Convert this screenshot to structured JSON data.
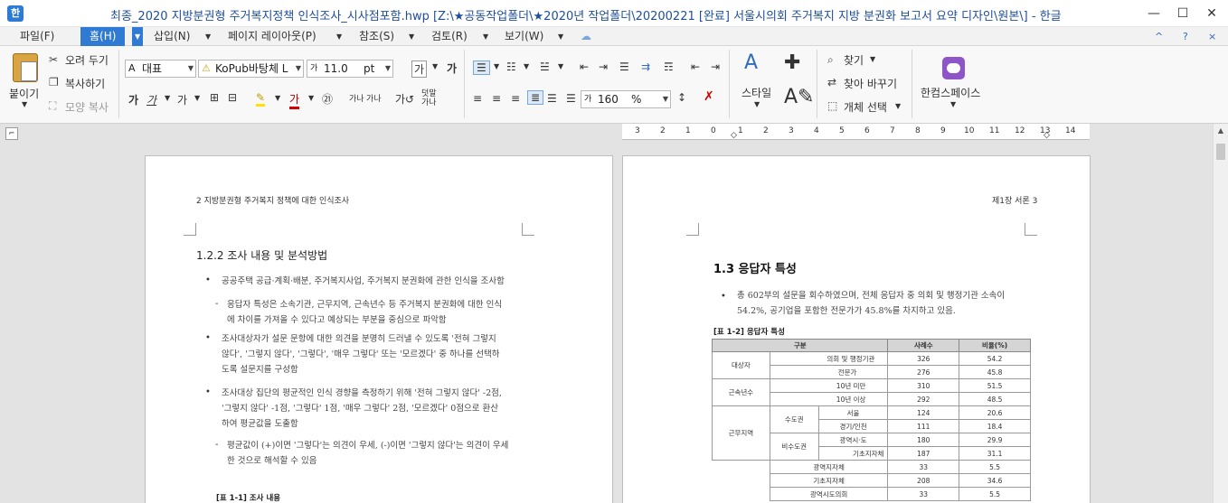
{
  "window": {
    "title": "최종_2020 지방분권형 주거복지정책 인식조사_시사점포함.hwp [Z:\\★공동작업폴더\\★2020년 작업폴더\\20200221 [완료] 서울시의회 주거복지 지방 분권화 보고서 요약 디자인\\원본\\] - 한글",
    "app_icon": "한",
    "controls": [
      "—",
      "☐",
      "✕"
    ]
  },
  "menu": {
    "items": [
      "파일(F)",
      "홈(H)",
      "삽입(N)",
      "페이지 레이아웃(P)",
      "참조(S)",
      "검토(R)",
      "보기(W)"
    ],
    "right": [
      "^",
      "?",
      "×"
    ]
  },
  "ribbon": {
    "paste": "붙이기",
    "cut": "오려 두기",
    "copy": "복사하기",
    "format_copy": "모양 복사",
    "style_combo": "대표",
    "font_combo": "KoPub바탕체 L",
    "size_combo": "11.0",
    "size_unit": "pt",
    "font_glyph_1": "가",
    "font_glyph_2": "가",
    "font_row2": [
      "가",
      "가",
      "가"
    ],
    "circle_num": "㉑",
    "line_spacing": "160",
    "line_spacing_unit": "%",
    "style_btn": "스타일",
    "find": "찾기",
    "replace": "찾아 바꾸기",
    "select_obj": "개체 선택",
    "hancom_space": "한컴스페이스"
  },
  "ruler": {
    "numbers": [
      "3",
      "2",
      "1",
      "0",
      "1",
      "2",
      "3",
      "4",
      "5",
      "6",
      "7",
      "8",
      "9",
      "10",
      "11",
      "12",
      "13",
      "14"
    ]
  },
  "left_page": {
    "header": "2  지방분권형  주거복지  정책에  대한  인식조사",
    "section_title": "1.2.2  조사  내용  및  분석방법",
    "paragraphs": [
      {
        "marker": "•",
        "lines": [
          "공공주택 공급·계획·배분, 주거복지사업, 주거복지 분권화에 관한 인식을 조사함"
        ]
      },
      {
        "marker": "-",
        "lines": [
          "응답자 특성은 소속기관, 근무지역, 근속년수 등 주거복지 분권화에 대한 인식",
          "에 차이를 가져올 수 있다고 예상되는 부분을 중심으로 파악함"
        ]
      },
      {
        "marker": "•",
        "lines": [
          "조사대상자가 설문 문항에 대한 의견을 분명히 드러낼 수 있도록 '전혀 그렇지",
          "않다', '그렇지 않다', '그렇다', '매우 그렇다' 또는 '모르겠다' 중 하나를 선택하",
          "도록 설문지를 구성함"
        ]
      },
      {
        "marker": "•",
        "lines": [
          "조사대상 집단의 평균적인 인식 경향을 측정하기 위해 '전혀 그렇지 않다' -2점,",
          "'그렇지 않다' -1점, '그렇다' 1점, '매우 그렇다' 2점, '모르겠다' 0점으로 환산",
          "하여 평균값을 도출함"
        ]
      },
      {
        "marker": "-",
        "lines": [
          "평균값이 (+)이면 '그렇다'는 의견이 우세, (-)이면 '그렇지 않다'는 의견이 우세",
          "한 것으로 해석할 수 있음"
        ]
      }
    ],
    "table_caption": "[표 1-1] 조사 내용"
  },
  "right_page": {
    "header": "제1장  서론  3",
    "section_title": "1.3  응답자  특성",
    "paragraph": [
      "총  602부의  설문을  회수하였으며,  전체  응답자  중  의회  및  행정기관  소속이",
      "54.2%,  공기업을  포함한  전문가가  45.8%를  차지하고  있음."
    ],
    "table_caption": "[표  1-2]  응답자  특성",
    "table": {
      "headers": [
        "구분",
        "사례수",
        "비율(%)"
      ],
      "rows": [
        {
          "g1": "대상자",
          "g2": "",
          "g3": "의회 및 행정기관",
          "n": "326",
          "p": "54.2"
        },
        {
          "g1": "",
          "g2": "",
          "g3": "전문가",
          "n": "276",
          "p": "45.8"
        },
        {
          "g1": "근속년수",
          "g2": "",
          "g3": "10년 미만",
          "n": "310",
          "p": "51.5"
        },
        {
          "g1": "",
          "g2": "",
          "g3": "10년 이상",
          "n": "292",
          "p": "48.5"
        },
        {
          "g1": "근무지역",
          "g2": "수도권",
          "g3": "서울",
          "n": "124",
          "p": "20.6"
        },
        {
          "g1": "",
          "g2": "",
          "g3": "경기/인천",
          "n": "111",
          "p": "18.4"
        },
        {
          "g1": "",
          "g2": "비수도권",
          "g3": "광역시·도",
          "n": "180",
          "p": "29.9"
        },
        {
          "g1": "",
          "g2": "",
          "g3": "기초지자체",
          "n": "187",
          "p": "31.1"
        },
        {
          "g1": "",
          "g2": "",
          "g3": "광역지자체",
          "n": "33",
          "p": "5.5"
        },
        {
          "g1": "",
          "g2": "",
          "g3": "기초지자체",
          "n": "208",
          "p": "34.6"
        },
        {
          "g1": "",
          "g2": "",
          "g3": "광역시도의회",
          "n": "33",
          "p": "5.5"
        }
      ]
    }
  }
}
